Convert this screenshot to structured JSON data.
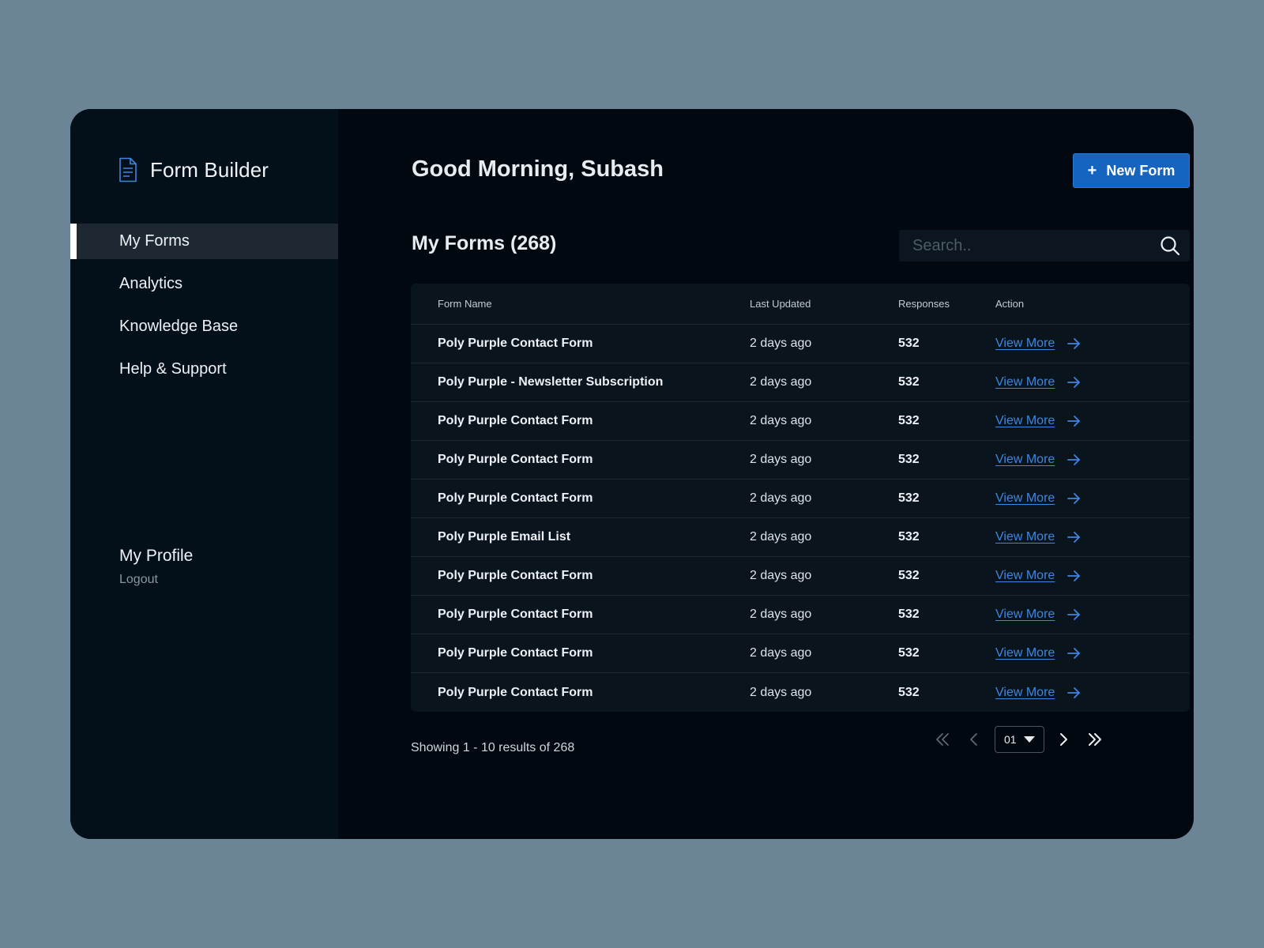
{
  "sidebar": {
    "brand": "Form Builder",
    "brand_icon": "document-icon",
    "nav": [
      {
        "label": "My Forms",
        "active": true
      },
      {
        "label": "Analytics",
        "active": false
      },
      {
        "label": "Knowledge Base",
        "active": false
      },
      {
        "label": "Help & Support",
        "active": false
      }
    ],
    "profile_label": "My Profile",
    "logout_label": "Logout"
  },
  "header": {
    "greeting": "Good Morning, Subash",
    "new_form_icon": "+",
    "new_form_label": "New Form"
  },
  "forms": {
    "title": "My Forms (268)",
    "search_placeholder": "Search..",
    "columns": {
      "name": "Form Name",
      "updated": "Last Updated",
      "responses": "Responses",
      "action": "Action"
    },
    "rows": [
      {
        "name": "Poly Purple Contact Form",
        "updated": "2 days ago",
        "responses": "532",
        "action": "View More"
      },
      {
        "name": "Poly Purple - Newsletter Subscription",
        "updated": "2 days ago",
        "responses": "532",
        "action": "View More"
      },
      {
        "name": "Poly Purple Contact Form",
        "updated": "2 days ago",
        "responses": "532",
        "action": "View More"
      },
      {
        "name": "Poly Purple Contact Form",
        "updated": "2 days ago",
        "responses": "532",
        "action": "View More"
      },
      {
        "name": "Poly Purple Contact Form",
        "updated": "2 days ago",
        "responses": "532",
        "action": "View More"
      },
      {
        "name": "Poly Purple Email List",
        "updated": "2 days ago",
        "responses": "532",
        "action": "View More"
      },
      {
        "name": "Poly Purple Contact Form",
        "updated": "2 days ago",
        "responses": "532",
        "action": "View More"
      },
      {
        "name": "Poly Purple Contact Form",
        "updated": "2 days ago",
        "responses": "532",
        "action": "View More"
      },
      {
        "name": "Poly Purple Contact Form",
        "updated": "2 days ago",
        "responses": "532",
        "action": "View More"
      },
      {
        "name": "Poly Purple Contact Form",
        "updated": "2 days ago",
        "responses": "532",
        "action": "View More"
      }
    ]
  },
  "pagination": {
    "summary": "Showing 1 - 10 results of 268",
    "current_page": "01"
  },
  "colors": {
    "background": "#6b8597",
    "sidebar": "#031019",
    "main": "#01080f",
    "accent": "#1565c0",
    "link": "#3f86e0"
  }
}
